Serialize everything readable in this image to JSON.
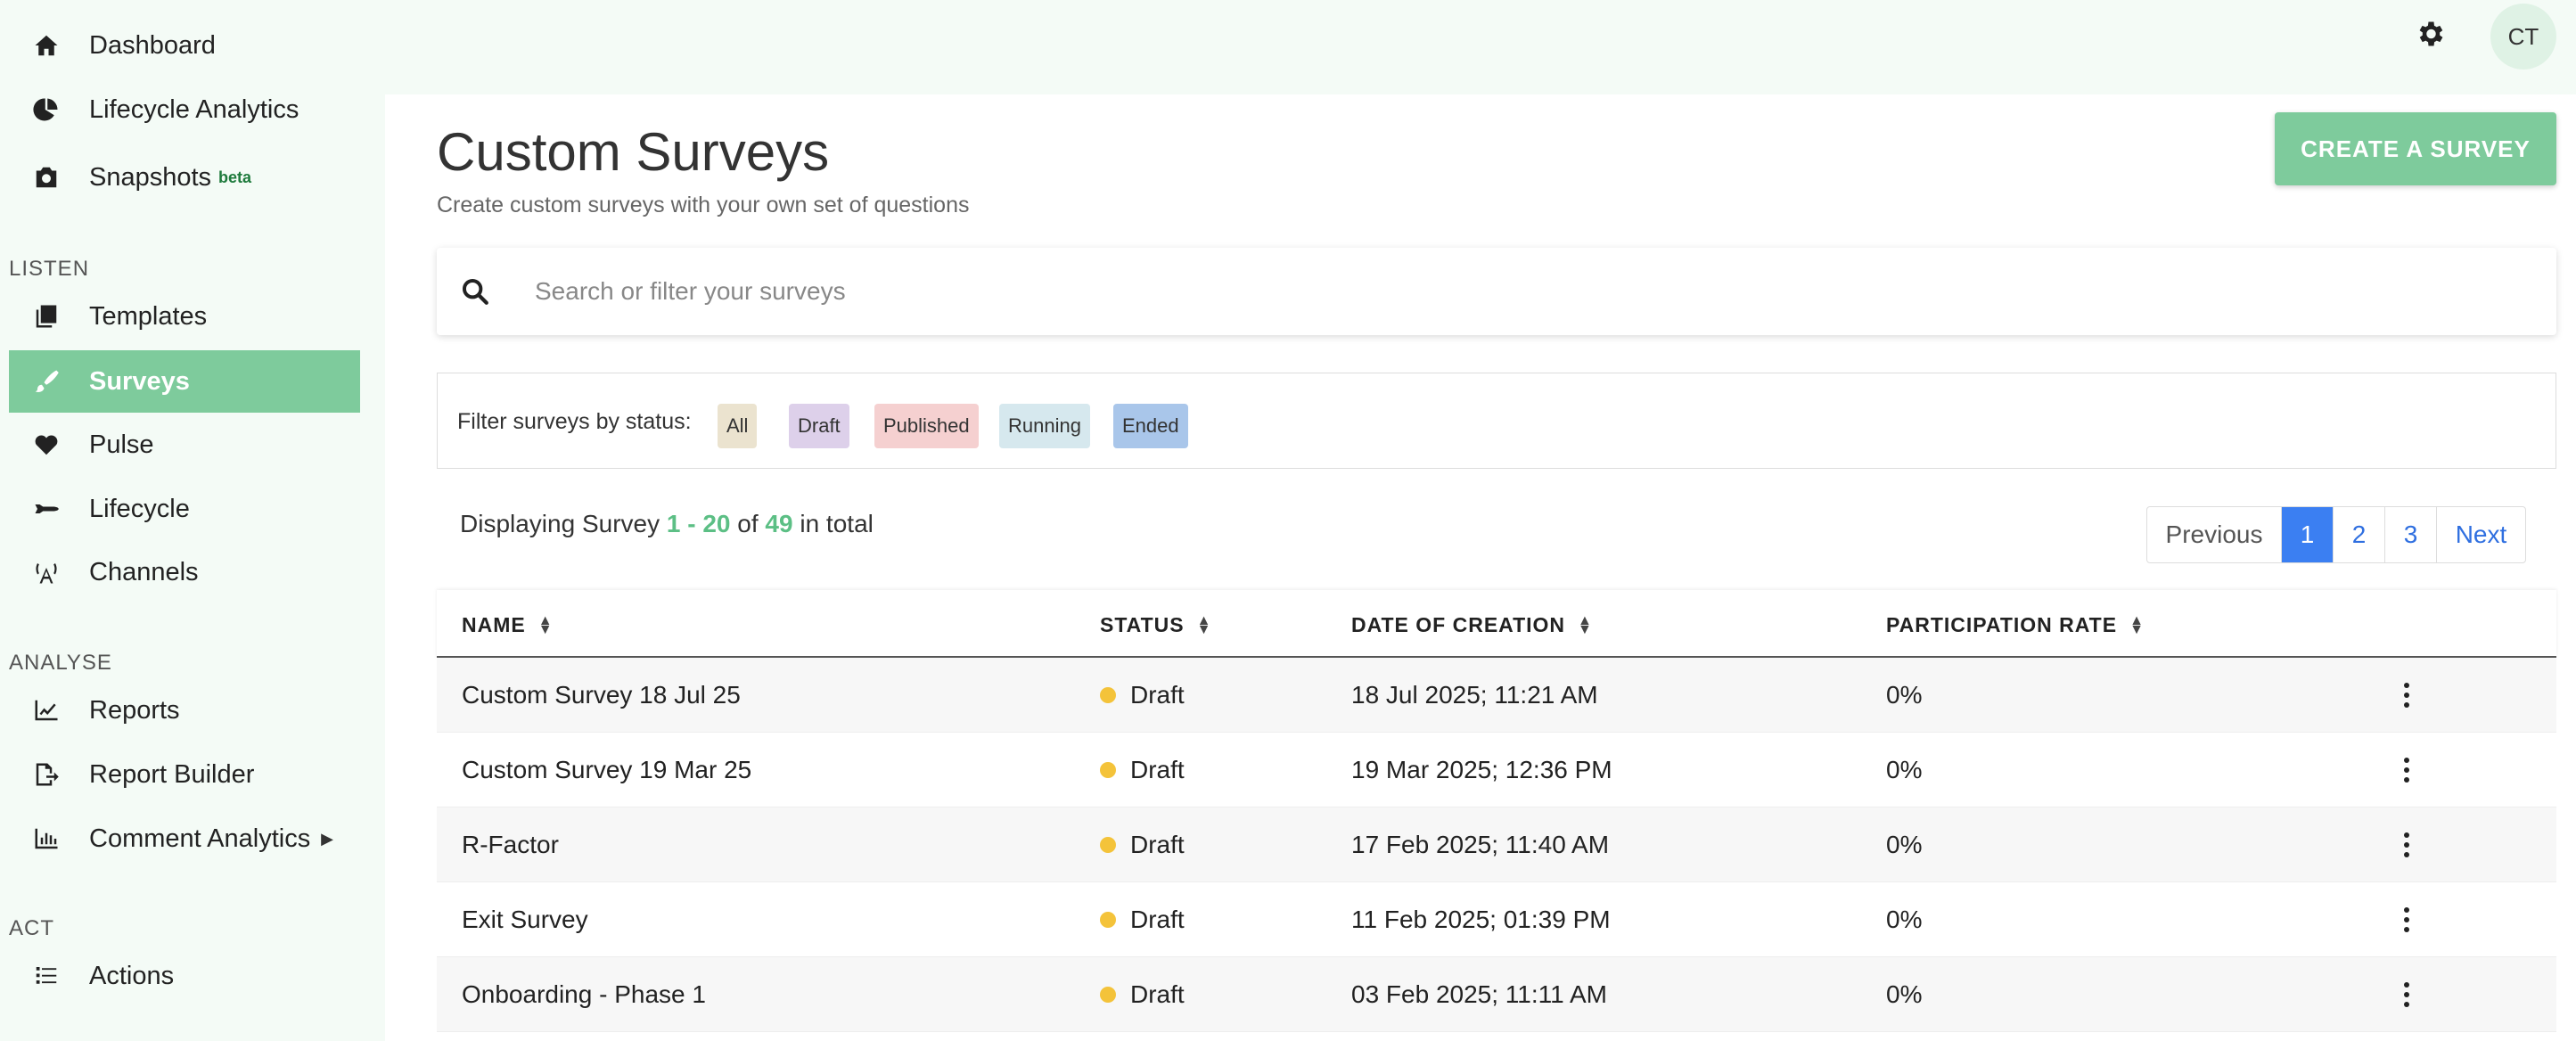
{
  "sidebar": {
    "items_top": [
      {
        "label": "Dashboard",
        "icon": "home-icon"
      },
      {
        "label": "Lifecycle Analytics",
        "icon": "pie-chart-icon"
      },
      {
        "label": "Snapshots",
        "badge": "beta",
        "icon": "camera-icon"
      }
    ],
    "sections": {
      "listen": "LISTEN",
      "analyse": "ANALYSE",
      "act": "ACT"
    },
    "listen_items": [
      {
        "label": "Templates",
        "icon": "copy-icon"
      },
      {
        "label": "Surveys",
        "icon": "paintbrush-icon",
        "active": true
      },
      {
        "label": "Pulse",
        "icon": "heartbeat-icon"
      },
      {
        "label": "Lifecycle",
        "icon": "shuttle-icon"
      },
      {
        "label": "Channels",
        "icon": "antenna-icon"
      }
    ],
    "analyse_items": [
      {
        "label": "Reports",
        "icon": "line-chart-icon"
      },
      {
        "label": "Report Builder",
        "icon": "file-export-icon"
      },
      {
        "label": "Comment Analytics",
        "icon": "bar-chart-icon"
      }
    ],
    "act_items": [
      {
        "label": "Actions",
        "icon": "list-icon"
      }
    ]
  },
  "header": {
    "avatar_initials": "CT"
  },
  "main": {
    "title": "Custom Surveys",
    "subtitle": "Create custom surveys with your own set of questions",
    "create_button": "CREATE A SURVEY",
    "search_placeholder": "Search or filter your surveys",
    "filter_label": "Filter surveys by status:",
    "filter_chips": [
      {
        "label": "All",
        "color": "#ebe3cf"
      },
      {
        "label": "Draft",
        "color": "#ddd0ea"
      },
      {
        "label": "Published",
        "color": "#f5d0d0"
      },
      {
        "label": "Running",
        "color": "#d6e8ee"
      },
      {
        "label": "Ended",
        "color": "#a9c6ea"
      }
    ],
    "display": {
      "prefix": "Displaying Survey",
      "range": "1 - 20",
      "of": "of",
      "total": "49",
      "suffix": "in total"
    },
    "pagination": {
      "previous": "Previous",
      "pages": [
        "1",
        "2",
        "3"
      ],
      "current": "1",
      "next": "Next"
    },
    "table": {
      "headers": {
        "name": "NAME",
        "status": "STATUS",
        "date": "DATE OF CREATION",
        "rate": "PARTICIPATION RATE"
      },
      "rows": [
        {
          "name": "Custom Survey 18 Jul 25",
          "status": "Draft",
          "date": "18 Jul 2025; 11:21 AM",
          "rate": "0%"
        },
        {
          "name": "Custom Survey 19 Mar 25",
          "status": "Draft",
          "date": "19 Mar 2025; 12:36 PM",
          "rate": "0%"
        },
        {
          "name": "R-Factor",
          "status": "Draft",
          "date": "17 Feb 2025; 11:40 AM",
          "rate": "0%"
        },
        {
          "name": "Exit Survey",
          "status": "Draft",
          "date": "11 Feb 2025; 01:39 PM",
          "rate": "0%"
        },
        {
          "name": "Onboarding - Phase 1",
          "status": "Draft",
          "date": "03 Feb 2025; 11:11 AM",
          "rate": "0%"
        }
      ]
    }
  },
  "colors": {
    "accent": "#7ecb9c",
    "draft_dot": "#f4c33a",
    "page_active": "#3b7ff2"
  }
}
